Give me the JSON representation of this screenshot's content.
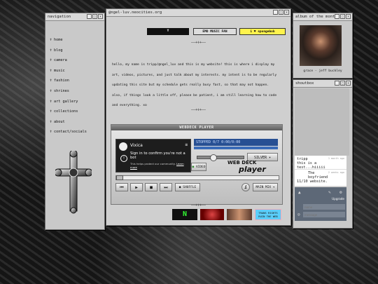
{
  "nav": {
    "title": "navigation",
    "items": [
      {
        "label": "home"
      },
      {
        "label": "blog"
      },
      {
        "label": "camera"
      },
      {
        "label": "music"
      },
      {
        "label": "fashion"
      },
      {
        "label": "shrines"
      },
      {
        "label": "art gallery"
      },
      {
        "label": "collections"
      },
      {
        "label": "about"
      },
      {
        "label": "contact/socials"
      }
    ]
  },
  "window_buttons": {
    "minimize": "_",
    "maximize": "□",
    "close": "x"
  },
  "main": {
    "title": "@ngel-luv.neocities.org",
    "badges": {
      "b1": "Y",
      "b2": "EMO MUSIC FAN",
      "b3": "i ♥ spongebob"
    },
    "divider": "——+♰+——",
    "intro": "hello, my name is tripp/@ngel_luv and this is my website! this is where i display my art, videos, pictures, and just talk about my interests. my intent is to be regularly updating this site but my schedule gets really busy fast, so that may not happen. also, if things look a little off, please be patient, i am still learning how to code and everything. xo"
  },
  "player": {
    "title": "WEBDECK PLAYER",
    "vixica": {
      "name": "Vixica",
      "heading": "Sign in to confirm you're not a bot",
      "body": "This helps protect our community.",
      "link": "Learn more"
    },
    "lcd_text": "STOPPED 0/7  0:00/0:00",
    "silver": "SILVER",
    "video_btn": "VIDEO",
    "logo_line1": "WEB DECK",
    "logo_line2": "player",
    "shuffle": "SHUFFLE",
    "info": "i",
    "mainmix": "MAIN MIX",
    "buttons": {
      "prev": "⏮",
      "play": "▶",
      "stop": "■",
      "next": "⏭"
    }
  },
  "bottom_badges": {
    "x1": "N",
    "x4": "TRANS RIGHTS RUIN THE WEB"
  },
  "album": {
    "title": "album of the month",
    "caption": "grace - jeff buckley"
  },
  "shoutbox": {
    "title": "shoutbox",
    "messages": [
      {
        "name": "tripp",
        "text": "this is a test...hiiiii",
        "time": "1 month ago"
      },
      {
        "name": "",
        "text": "The boyfriend",
        "time": "2 weeks ago"
      },
      {
        "name": "",
        "text": "11/10 website.",
        "time": ""
      }
    ],
    "upgrade": "Upgrade",
    "name_placeholder": "name",
    "message_placeholder": "message"
  },
  "colors": {
    "accent_blue": "#274f93",
    "window_grey": "#c9c9c9"
  }
}
